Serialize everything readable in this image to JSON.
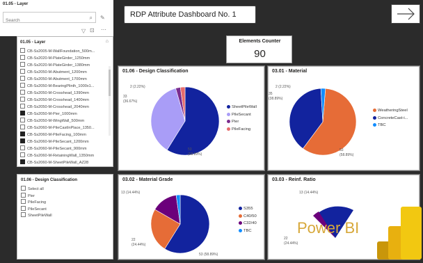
{
  "layer_slicer": {
    "title": "01.05 - Layer",
    "search_placeholder": "Search",
    "list_title": "01.05 - Layer",
    "items": [
      {
        "label": "CB-Ss2005-M-WallFoundation_500m...",
        "checked": false
      },
      {
        "label": "CB-Ss2020-M-PlateGirder_1250mm",
        "checked": false
      },
      {
        "label": "CB-Ss2020-M-PlateGirder_1380mm",
        "checked": false
      },
      {
        "label": "CB-Ss2050-M-Abutment_1200mm",
        "checked": false
      },
      {
        "label": "CB-Ss2050-M-Abutment_1700mm",
        "checked": false
      },
      {
        "label": "CB-Ss2050-M-BearingPlinth_1000x1...",
        "checked": false
      },
      {
        "label": "CB-Ss2050-M-Crosshead_1390mm",
        "checked": false
      },
      {
        "label": "CB-Ss2050-M-Crosshead_1400mm",
        "checked": false
      },
      {
        "label": "CB-Ss2050-M-Crosshead_2040mm",
        "checked": false
      },
      {
        "label": "CB-Ss2050-M-Pier_1000mm",
        "checked": true
      },
      {
        "label": "CB-Ss2050-M-WingWall_500mm",
        "checked": false
      },
      {
        "label": "CB-Ss2060-M-PileCastInPlace_1350...",
        "checked": false
      },
      {
        "label": "CB-Ss2060-M-PileFacing_100mm",
        "checked": true
      },
      {
        "label": "CB-Ss2060-M-PileSecant_1200mm",
        "checked": true
      },
      {
        "label": "CB-Ss2060-M-PileSecant_900mm",
        "checked": false
      },
      {
        "label": "CB-Ss2060-M-RetainingWall_1350mm",
        "checked": false
      },
      {
        "label": "CB-Ss2060-M-SheetPileWall_AZ28",
        "checked": true
      }
    ]
  },
  "design_slicer": {
    "title": "01.06 - Design Classification",
    "items": [
      "Select all",
      "Pier",
      "PileFacing",
      "PileSecant",
      "SheetPileWall"
    ]
  },
  "dashboard_title": "RDP Attribute Dashboard No. 1",
  "counter": {
    "label": "Elements Counter",
    "value": "90"
  },
  "chart_data": [
    {
      "type": "pie",
      "title": "01.06 - Design Classification",
      "categories": [
        "SheetPileWall",
        "PileSecant",
        "Pier",
        "PileFacing"
      ],
      "values": [
        53,
        33,
        2,
        2
      ],
      "colors": [
        "#12239e",
        "#a99df7",
        "#7b2c8e",
        "#e66c6c"
      ],
      "data_labels": {
        "SheetPileWall": [
          "53",
          "(58.89%)"
        ],
        "PileSecant": [
          "33",
          "(36.67%)"
        ],
        "PileFacing": [
          "2 (2.22%)",
          ""
        ]
      }
    },
    {
      "type": "pie",
      "title": "03.01 - Material",
      "categories": [
        "WeatheringSteel",
        "ConcreteCast-i...",
        "TBC"
      ],
      "values": [
        53,
        35,
        2
      ],
      "colors": [
        "#e66c37",
        "#12239e",
        "#118dff"
      ],
      "data_labels": {
        "WeatheringSteel": [
          "53",
          "(58.89%)"
        ],
        "ConcreteCast-i...": [
          "35",
          "(38.89%)"
        ],
        "TBC": [
          "2 (2.22%)",
          ""
        ]
      }
    },
    {
      "type": "pie",
      "title": "03.02 - Material Grade",
      "categories": [
        "S355",
        "C40/50",
        "C32/40",
        "TBC"
      ],
      "values": [
        53,
        22,
        13,
        2
      ],
      "colors": [
        "#12239e",
        "#e66c37",
        "#6b007b",
        "#118dff"
      ],
      "data_labels": {
        "S355": [
          "53 (58.89%)",
          ""
        ],
        "C40/50": [
          "22",
          "(24.44%)"
        ],
        "C32/40": [
          "13 (14.44%)",
          ""
        ]
      }
    },
    {
      "type": "pie",
      "title": "03.03 - Reinf. Ratio",
      "categories": [],
      "values": [],
      "data_labels": {
        "a": [
          "13 (14.44%)",
          ""
        ],
        "b": [
          "22",
          "(24.44%)"
        ]
      }
    }
  ],
  "powerbi": {
    "wordmark": "Power BI",
    "colors": [
      "#f2c811",
      "#e8b00f",
      "#c9960a"
    ]
  }
}
